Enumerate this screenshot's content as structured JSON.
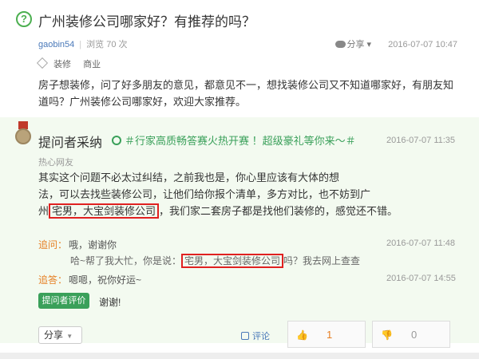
{
  "question": {
    "title": "广州装修公司哪家好？有推荐的吗？",
    "user": "gaobin54",
    "views": "浏览 70 次",
    "share_label": "分享",
    "time": "2016-07-07 10:47",
    "tags": [
      "装修",
      "商业"
    ],
    "body": "房子想装修，问了好多朋友的意见，都意见不一，想找装修公司又不知道哪家好，有朋友知道吗？广州装修公司哪家好，欢迎大家推荐。"
  },
  "answer": {
    "adopt_title": "提问者采纳",
    "promo": "＃行家高质畅答赛火热开赛 ！超级豪礼等你来～＃",
    "time": "2016-07-07 11:35",
    "answerer": "热心网友",
    "line1": "其实这个问题不必太过纠结，之前我也是，你心里应该有大体的想",
    "line2": "法，可以去找些装修公司，让他们给你报个清单，多方对比，也不妨到广",
    "line3_pre": "州",
    "line3_hl": "宅男，大宝剑装修公司",
    "line3_post": "，我们家二套房子都是找他们装修的，感觉还不错。"
  },
  "follow_ups": [
    {
      "label": "追问：",
      "text": "哦，谢谢你",
      "time": "2016-07-07 11:48"
    },
    {
      "text_pre": "哈~帮了我大忙，你是说：",
      "text_hl": "宅男，大宝剑装修公司",
      "text_post": "吗？我去网上查查"
    },
    {
      "label": "追答：",
      "text": "嗯嗯，祝你好运~",
      "time": "2016-07-07 14:55"
    }
  ],
  "rating": {
    "button": "提问者评价",
    "text": "谢谢!"
  },
  "footer": {
    "share": "分享",
    "comment": "评论",
    "likes": "1",
    "dislikes": "0"
  },
  "colors": {
    "accent": "#3aa05a",
    "highlight_border": "#e02020",
    "follow_label": "#e67e22",
    "answer_bg": "#f3faf0"
  }
}
